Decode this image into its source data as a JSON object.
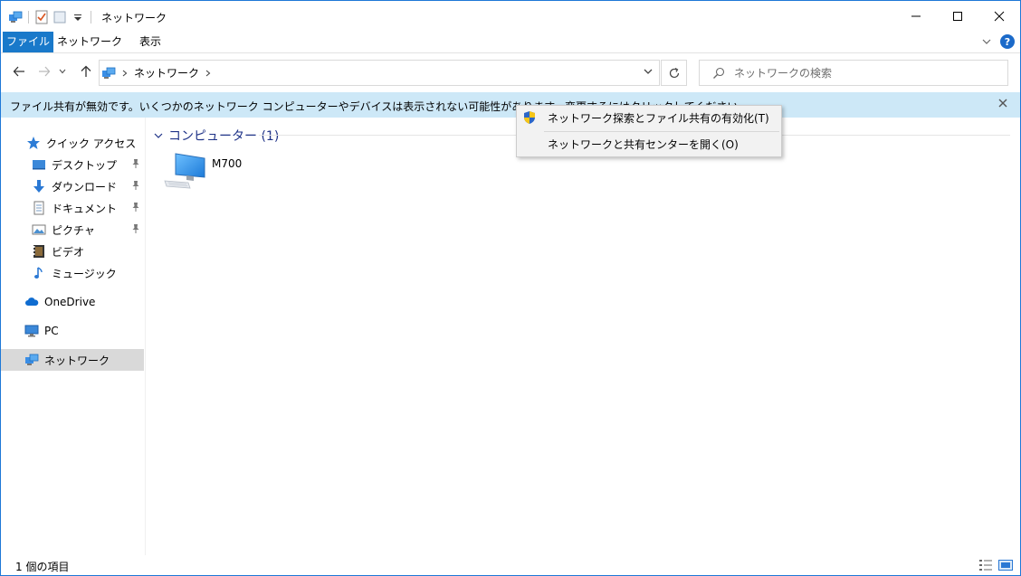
{
  "window": {
    "title": "ネットワーク",
    "accent": "#1979ca"
  },
  "ribbon": {
    "tabs": [
      "ファイル",
      "ネットワーク",
      "表示"
    ],
    "help_label": "?"
  },
  "address": {
    "location": "ネットワーク",
    "search_placeholder": "ネットワークの検索"
  },
  "infobar": {
    "message": "ファイル共有が無効です。いくつかのネットワーク コンピューターやデバイスは表示されない可能性があります。変更するにはクリックしてください...",
    "background": "#cde8f7"
  },
  "navpane": {
    "quick_access": "クイック アクセス",
    "items": [
      {
        "label": "デスクトップ",
        "icon": "desktop-icon",
        "pinned": true
      },
      {
        "label": "ダウンロード",
        "icon": "download-icon",
        "pinned": true
      },
      {
        "label": "ドキュメント",
        "icon": "document-icon",
        "pinned": true
      },
      {
        "label": "ピクチャ",
        "icon": "pictures-icon",
        "pinned": true
      },
      {
        "label": "ビデオ",
        "icon": "video-icon",
        "pinned": false
      },
      {
        "label": "ミュージック",
        "icon": "music-icon",
        "pinned": false
      }
    ],
    "onedrive": "OneDrive",
    "pc": "PC",
    "network": "ネットワーク"
  },
  "content": {
    "group_label": "コンピューター (1)",
    "computers": [
      {
        "name": "M700",
        "icon": "computer-icon"
      }
    ]
  },
  "context_menu": {
    "items": [
      {
        "label": "ネットワーク探索とファイル共有の有効化(T)",
        "icon": "uac-shield-icon"
      },
      {
        "label": "ネットワークと共有センターを開く(O)"
      }
    ]
  },
  "statusbar": {
    "item_count": "1 個の項目"
  }
}
